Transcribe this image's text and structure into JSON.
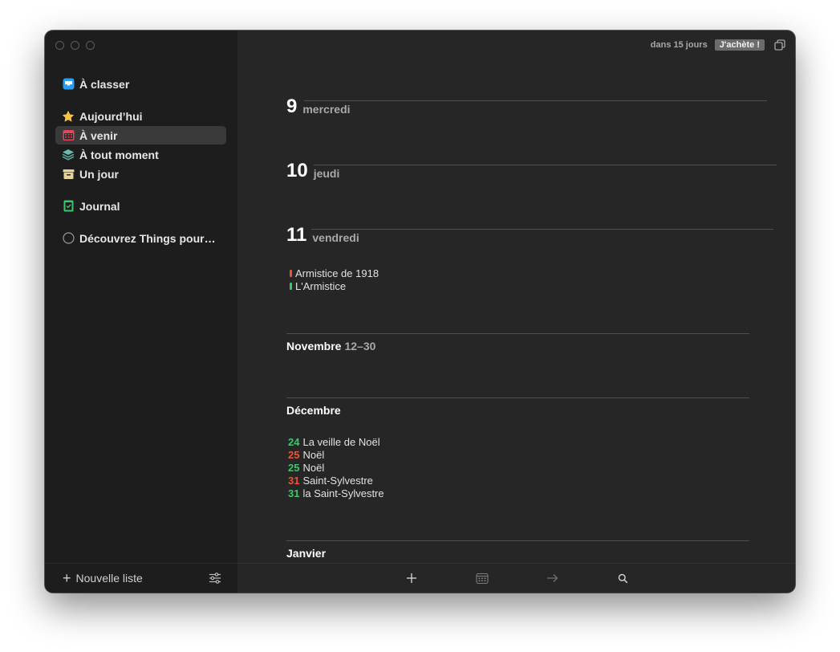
{
  "sidebar": {
    "items": [
      {
        "label": "À classer",
        "icon": "inbox-icon"
      },
      {
        "label": "Aujourd’hui",
        "icon": "star-icon"
      },
      {
        "label": "À venir",
        "icon": "calendar-icon"
      },
      {
        "label": "À tout moment",
        "icon": "layers-icon"
      },
      {
        "label": "Un jour",
        "icon": "archive-box-icon"
      },
      {
        "label": "Journal",
        "icon": "logbook-icon"
      },
      {
        "label": "Découvrez Things pour…",
        "icon": "circle-icon"
      }
    ],
    "selected_index": 2,
    "new_list_label": "Nouvelle liste"
  },
  "topbar": {
    "relative_date": "dans 15 jours",
    "buy_button": "J'achète !"
  },
  "days": [
    {
      "num": "9",
      "name": "mercredi"
    },
    {
      "num": "10",
      "name": "jeudi"
    },
    {
      "num": "11",
      "name": "vendredi",
      "events": [
        {
          "label": "Armistice de 1918",
          "color": "#e8543a"
        },
        {
          "label": "L'Armistice",
          "color": "#3fc46f"
        }
      ]
    }
  ],
  "months": [
    {
      "name": "Novembre",
      "range": "12–30"
    },
    {
      "name": "Décembre",
      "events": [
        {
          "day": "24",
          "label": "La veille de Noël",
          "color": "#3fc46f"
        },
        {
          "day": "25",
          "label": "Noël",
          "color": "#e8543a"
        },
        {
          "day": "25",
          "label": "Noël",
          "color": "#3fc46f"
        },
        {
          "day": "31",
          "label": "Saint-Sylvestre",
          "color": "#e8543a"
        },
        {
          "day": "31",
          "label": "la Saint-Sylvestre",
          "color": "#3fc46f"
        }
      ]
    },
    {
      "name": "Janvier"
    }
  ],
  "colors": {
    "accent_blue": "#2a9df4",
    "star_yellow": "#f6c342",
    "calendar_red": "#e8435a",
    "layers_teal": "#5aa9a0",
    "someday_tan": "#e4d29a",
    "logbook_green": "#3fc46f"
  }
}
